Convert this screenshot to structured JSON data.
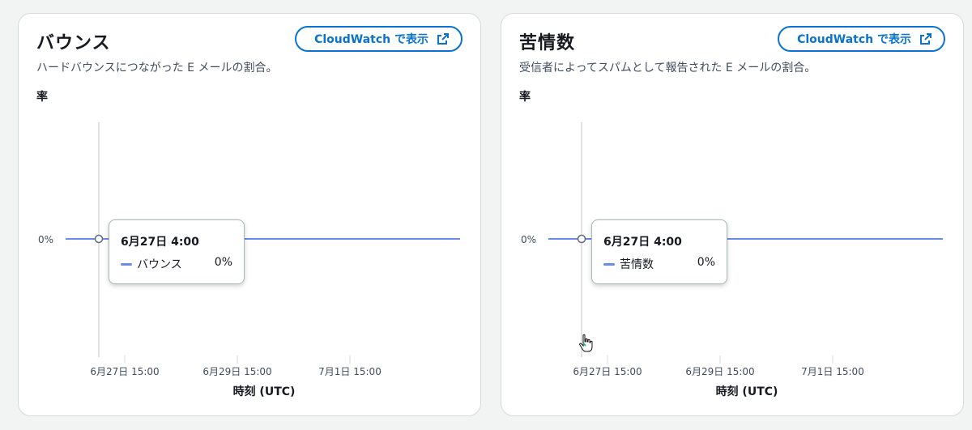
{
  "panels": [
    {
      "title": "バウンス",
      "button_label": "CloudWatch で表示",
      "description": "ハードバウンスにつながった E メールの割合。",
      "tooltip": {
        "time": "6月27日 4:00",
        "series": "バウンス",
        "value": "0%"
      }
    },
    {
      "title": "苦情数",
      "button_label": "CloudWatch で表示",
      "description": "受信者によってスパムとして報告された E メールの割合。",
      "tooltip": {
        "time": "6月27日 4:00",
        "series": "苦情数",
        "value": "0%"
      }
    }
  ],
  "chart_data": [
    {
      "type": "line",
      "ylabel": "率",
      "xlabel": "時刻 (UTC)",
      "y_ticks": [
        "0%"
      ],
      "x_ticks": [
        "6月27日 15:00",
        "6月29日 15:00",
        "7月1日 15:00"
      ],
      "series": [
        {
          "name": "バウンス",
          "values": [
            0,
            0,
            0,
            0
          ]
        }
      ],
      "line_color": "#688ae8"
    },
    {
      "type": "line",
      "ylabel": "率",
      "xlabel": "時刻 (UTC)",
      "y_ticks": [
        "0%"
      ],
      "x_ticks": [
        "6月27日 15:00",
        "6月29日 15:00",
        "7月1日 15:00"
      ],
      "series": [
        {
          "name": "苦情数",
          "values": [
            0,
            0,
            0,
            0
          ]
        }
      ],
      "line_color": "#688ae8"
    }
  ]
}
